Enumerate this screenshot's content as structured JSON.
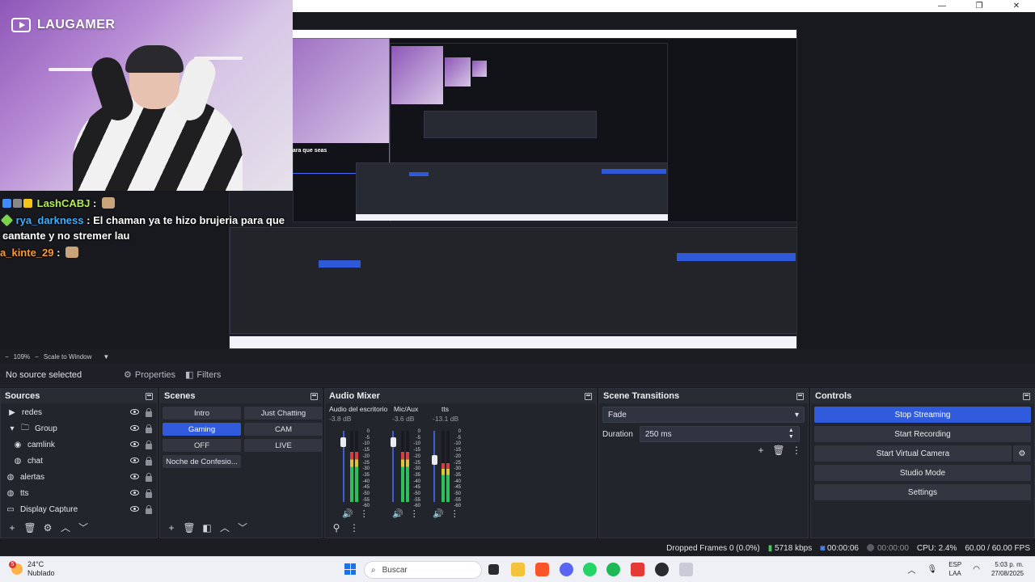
{
  "overlay": {
    "channel_name": "LAUGAMER",
    "chat": [
      {
        "user": "LashCABJ",
        "sep": ":",
        "text": ""
      },
      {
        "user": "rya_darkness",
        "sep": ":",
        "text": "El chaman ya te hizo brujeria para que seas"
      },
      {
        "user": "",
        "sep": "",
        "text": "cantante y no stremer lau"
      },
      {
        "user": "a_kinte_29",
        "sep": ":",
        "text": ""
      }
    ]
  },
  "preview": {
    "nested_caption": "an ya te hizo brujeria para que seas"
  },
  "scalebar": {
    "zoom": "109%",
    "mode": "Scale to Window"
  },
  "source_bar": {
    "status": "No source selected",
    "properties": "Properties",
    "filters": "Filters"
  },
  "sources": {
    "title": "Sources",
    "items": [
      {
        "label": "redes",
        "icon": "play-icon",
        "indent": 0
      },
      {
        "label": "Group",
        "icon": "folder-icon",
        "indent": 1
      },
      {
        "label": "camlink",
        "icon": "camera-icon",
        "indent": 2
      },
      {
        "label": "chat",
        "icon": "globe-icon",
        "indent": 2
      },
      {
        "label": "alertas",
        "icon": "globe-icon",
        "indent": 0
      },
      {
        "label": "tts",
        "icon": "globe-icon",
        "indent": 0
      },
      {
        "label": "Display Capture",
        "icon": "monitor-icon",
        "indent": 0
      }
    ]
  },
  "scenes": {
    "title": "Scenes",
    "items": [
      "Intro",
      "Just Chatting",
      "Gaming",
      "CAM",
      "OFF",
      "LIVE",
      "Noche de Confesio..."
    ],
    "active": "Gaming"
  },
  "mixer": {
    "title": "Audio Mixer",
    "channels": [
      {
        "name": "Audio del escritorio",
        "db": "-3.8 dB",
        "level": 0.7
      },
      {
        "name": "Mic/Aux",
        "db": "-3.6 dB",
        "level": 0.7
      },
      {
        "name": "tts",
        "db": "-13.1 dB",
        "level": 0.55
      }
    ],
    "scale": [
      "0",
      "-5",
      "-10",
      "-15",
      "-20",
      "-25",
      "-30",
      "-35",
      "-40",
      "-45",
      "-50",
      "-55",
      "-60"
    ]
  },
  "transitions": {
    "title": "Scene Transitions",
    "selected": "Fade",
    "duration_label": "Duration",
    "duration_value": "250 ms"
  },
  "controls": {
    "title": "Controls",
    "stop_streaming": "Stop Streaming",
    "start_recording": "Start Recording",
    "start_virtual_camera": "Start Virtual Camera",
    "studio_mode": "Studio Mode",
    "settings": "Settings"
  },
  "status": {
    "dropped": "Dropped Frames 0 (0.0%)",
    "kbps": "5718 kbps",
    "stream_time": "00:00:06",
    "rec_time": "00:00:00",
    "cpu": "CPU: 2.4%",
    "fps": "60.00 / 60.00 FPS"
  },
  "taskbar": {
    "weather_temp": "24°C",
    "weather_desc": "Nublado",
    "weather_badge": "5",
    "search": "Buscar",
    "lang_top": "ESP",
    "lang_bottom": "LAA",
    "time": "5:03 p. m.",
    "date": "27/08/2025"
  }
}
